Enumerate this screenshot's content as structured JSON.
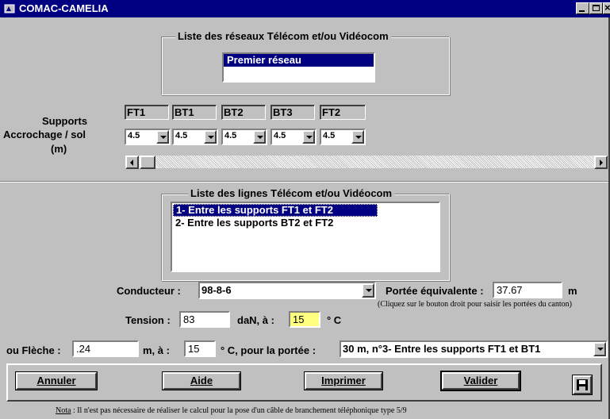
{
  "window": {
    "title": "COMAC-CAMELIA"
  },
  "networks": {
    "group_title": "Liste des réseaux Télécom et/ou Vidéocom",
    "items": [
      "Premier réseau",
      ""
    ]
  },
  "supports": {
    "label": "Supports",
    "accrochage_label": "Accrochage / sol",
    "unit_label": "(m)",
    "columns": [
      {
        "name": "FT1",
        "height": "4.5"
      },
      {
        "name": "BT1",
        "height": "4.5"
      },
      {
        "name": "BT2",
        "height": "4.5"
      },
      {
        "name": "BT3",
        "height": "4.5"
      },
      {
        "name": "FT2",
        "height": "4.5"
      }
    ]
  },
  "lines": {
    "group_title": "Liste des lignes Télécom et/ou Vidéocom",
    "items": [
      "1-  Entre les supports FT1  et FT2",
      "2-  Entre les supports BT2  et FT2"
    ]
  },
  "form": {
    "conducteur_label": "Conducteur :",
    "conducteur_value": "98-8-6",
    "portee_label": "Portée équivalente :",
    "portee_value": "37.67",
    "portee_unit": "m",
    "hint": "(Cliquez sur le bouton droit pour saisir les portées du canton)",
    "tension_label": "Tension :",
    "tension_value": "83",
    "dan_label": "daN, à :",
    "tension_temp": "15",
    "deg_c_1": "° C",
    "fleche_label": "ou Flèche :",
    "fleche_value": ".24",
    "fleche_unit": "m, à :",
    "fleche_temp": "15",
    "pour_portee_label": "° C, pour la portée :",
    "portee_select": "30 m, n°3-  Entre les supports FT1  et BT1"
  },
  "buttons": {
    "annuler": "Annuler",
    "aide": "Aide",
    "imprimer": "Imprimer",
    "valider": "Valider"
  },
  "footer": {
    "note_label": "Nota",
    "note_text": " : Il n'est pas nécessaire de réaliser le calcul pour la pose d'un câble de branchement téléphonique type 5/9"
  },
  "colors": {
    "title_bar": "#000080",
    "face": "#c0c0c0",
    "highlight_field": "#ffff80"
  }
}
